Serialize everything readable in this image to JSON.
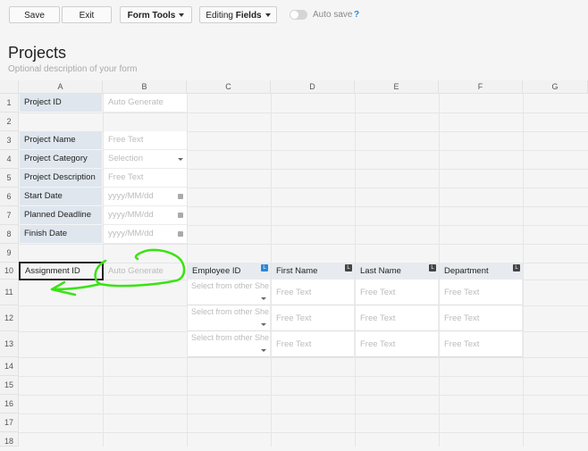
{
  "toolbar": {
    "save_label": "Save",
    "exit_label": "Exit",
    "form_tools_label": "Form Tools",
    "editing_prefix": "Editing",
    "editing_bold": "Fields",
    "autosave_label": "Auto save",
    "help_label": "?"
  },
  "form": {
    "title": "Projects",
    "description": "Optional description of your form"
  },
  "columns": [
    "A",
    "B",
    "C",
    "D",
    "E",
    "F",
    "G"
  ],
  "rows": [
    "1",
    "2",
    "3",
    "4",
    "5",
    "6",
    "7",
    "8",
    "9",
    "10",
    "11",
    "12",
    "13",
    "14",
    "15",
    "16",
    "17",
    "18"
  ],
  "fields": [
    {
      "label": "Project ID",
      "value": "Auto Generate"
    },
    {
      "label": "Project Name",
      "value": "Free Text"
    },
    {
      "label": "Project Category",
      "value": "Selection"
    },
    {
      "label": "Project Description",
      "value": "Free Text"
    },
    {
      "label": "Start Date",
      "value": "yyyy/MM/dd"
    },
    {
      "label": "Planned Deadline",
      "value": "yyyy/MM/dd"
    },
    {
      "label": "Finish Date",
      "value": "yyyy/MM/dd"
    }
  ],
  "assignment": {
    "label": "Assignment ID",
    "value": "Auto Generate"
  },
  "subtable": {
    "headers": [
      {
        "label": "Employee ID",
        "tag": "L"
      },
      {
        "label": "First Name",
        "tag": "L"
      },
      {
        "label": "Last Name",
        "tag": "L"
      },
      {
        "label": "Department",
        "tag": "L"
      }
    ],
    "select_text": "Select from other She",
    "free_text": "Free Text"
  },
  "annotation_color": "#39e312"
}
